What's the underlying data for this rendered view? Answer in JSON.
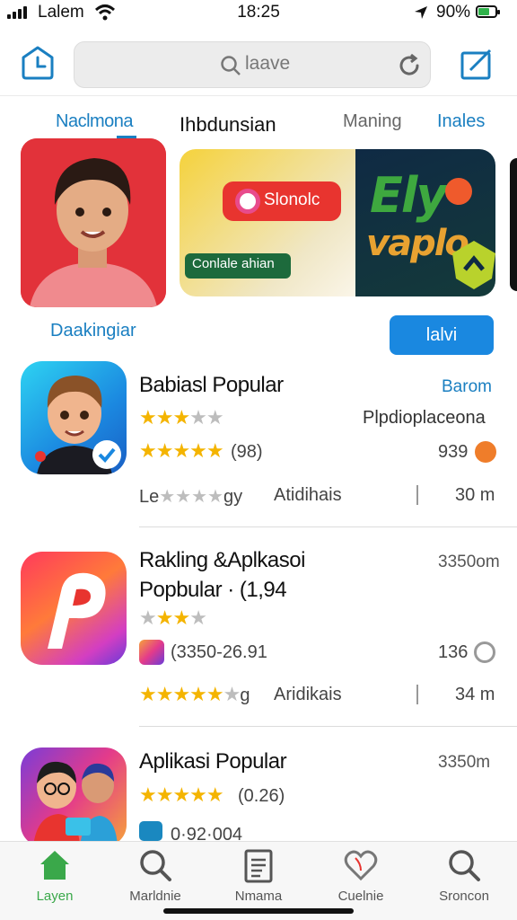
{
  "status_bar": {
    "carrier": "Lalem",
    "time": "18:25",
    "battery": "90%"
  },
  "search": {
    "placeholder": "laave"
  },
  "tabs": [
    "Naclmona",
    "Ihbdunsian",
    "Maning",
    "Inales"
  ],
  "banners": {
    "mid_red_pill": "Slonolc",
    "mid_green_pill": "Conlale ahian",
    "mid_title_line1": "Ely",
    "mid_title_line2": "vaplo"
  },
  "banner_caption": "Daakingiar",
  "banner_button": "lalvi",
  "apps": [
    {
      "title": "Babiasl Popular",
      "right_link": "Barom",
      "sub_right": "Plpdioplaceona",
      "rating_text": "(98)",
      "count": "939",
      "meta_left_prefix": "Le",
      "meta_left_suffix": "gy",
      "meta_mid": "Atidihais",
      "meta_right": "30 m",
      "colors": {
        "badge": "#ef7d2a"
      }
    },
    {
      "title_line1": "Rakling &Aplkasoi",
      "title_line2": "Popbular · (1,94",
      "right_top": "3350om",
      "ig_text": "(3350-26.91",
      "count": "136",
      "meta_suffix": "g",
      "meta_mid": "Aridikais",
      "meta_right": "34 m"
    },
    {
      "title": "Aplikasi Popular",
      "right_top": "3350m",
      "rating_text": "(0.26)",
      "partial_text": "0·92·004"
    }
  ],
  "bottom_nav": [
    {
      "label": "Layen",
      "icon": "home-icon",
      "active": true
    },
    {
      "label": "Marldnie",
      "icon": "search-icon",
      "active": false
    },
    {
      "label": "Nmama",
      "icon": "document-icon",
      "active": false
    },
    {
      "label": "Cuelnie",
      "icon": "heart-icon",
      "active": false
    },
    {
      "label": "Sroncon",
      "icon": "search-icon",
      "active": false
    }
  ],
  "colors": {
    "accent": "#1a7fc1",
    "button": "#1a88e0",
    "active_nav": "#3aa84a",
    "star": "#f4b400"
  }
}
